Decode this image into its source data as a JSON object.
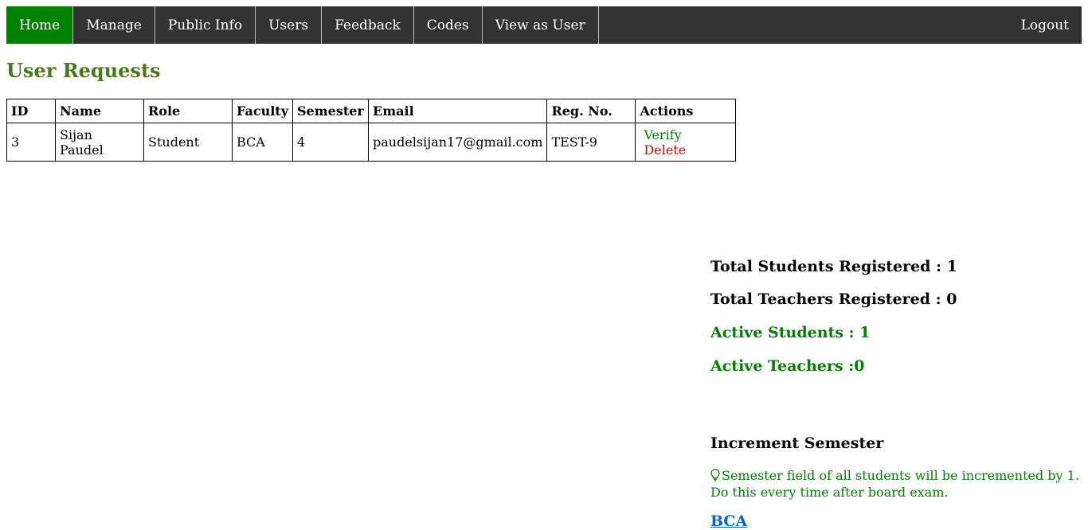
{
  "nav": {
    "items": [
      {
        "label": "Home"
      },
      {
        "label": "Manage"
      },
      {
        "label": "Public Info"
      },
      {
        "label": "Users"
      },
      {
        "label": "Feedback"
      },
      {
        "label": "Codes"
      },
      {
        "label": "View as User"
      }
    ],
    "logout": "Logout",
    "active_color": "#008000",
    "bar_color": "#333333"
  },
  "page": {
    "title": "User Requests"
  },
  "table": {
    "headers": [
      "ID",
      "Name",
      "Role",
      "Faculty",
      "Semester",
      "Email",
      "Reg. No.",
      "Actions"
    ],
    "rows": [
      {
        "id": "3",
        "name": "Sijan Paudel",
        "role": "Student",
        "faculty": "BCA",
        "semester": "4",
        "email": "paudelsijan17@gmail.com",
        "reg_no": "TEST-9",
        "verify": "Verify",
        "delete": "Delete"
      }
    ]
  },
  "stats": {
    "total_students": "Total Students Registered : 1",
    "total_teachers": "Total Teachers Registered : 0",
    "active_students": "Active Students : 1",
    "active_teachers": "Active Teachers :0"
  },
  "increment": {
    "title": "Increment Semester",
    "icon": "lightbulb-icon",
    "note": "Semester field of all students will be incremented by 1. Do this every time after board exam.",
    "faculty_link": "BCA"
  }
}
